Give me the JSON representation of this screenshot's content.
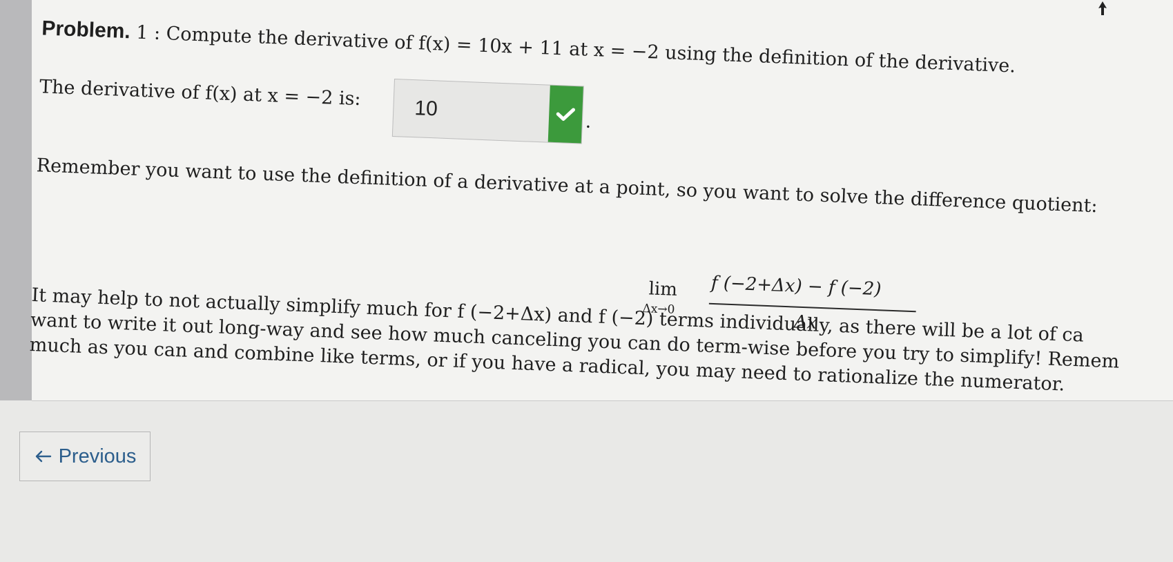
{
  "problem": {
    "label": "Problem.",
    "number": "1 :",
    "line1": "Compute the derivative of f(x) = 10x + 11 at x = −2 using the definition of the derivative."
  },
  "answer": {
    "prompt": "The derivative of f(x) at x = −2 is:",
    "value": "10",
    "period": ".",
    "status_color": "#3c9a3c"
  },
  "hint": {
    "line1": "Remember you want to use the definition of a derivative at a point, so you want to solve the difference quotient:",
    "lim": "lim",
    "lim_sub": "Δx→0",
    "numerator": "f (−2+Δx) − f (−2)",
    "denominator": "Δx",
    "para_line1": "It may help to not actually simplify much for f (−2+Δx) and f (−2) terms individually, as there will be a lot of ca",
    "para_line2": "want to write it out long-way and see how much canceling you can do term-wise before you try to simplify! Remem",
    "para_line3": "much as you can and combine like terms, or if you have a radical, you may need to rationalize the numerator."
  },
  "nav": {
    "previous_label": "Previous",
    "previous_icon": "arrow-left-icon"
  }
}
